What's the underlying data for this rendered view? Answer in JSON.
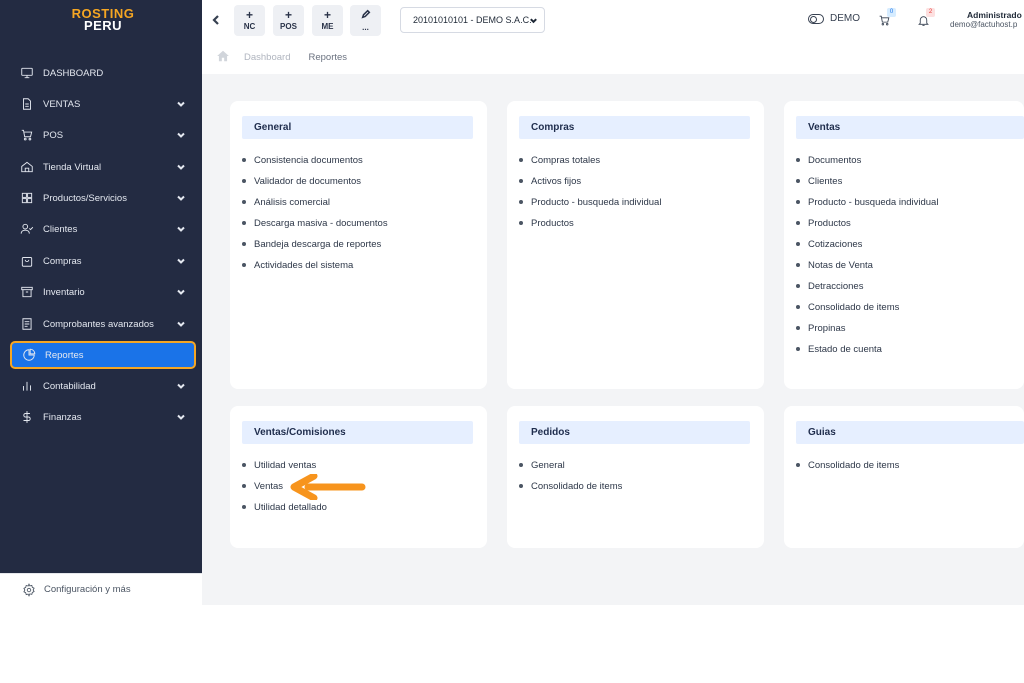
{
  "logo": {
    "line1": "ROSTING",
    "line2": "PERU"
  },
  "sidebar": {
    "items": [
      {
        "label": "DASHBOARD",
        "icon": "monitor-icon",
        "has_chevron": false
      },
      {
        "label": "VENTAS",
        "icon": "document-icon",
        "has_chevron": true
      },
      {
        "label": "POS",
        "icon": "cart-icon",
        "has_chevron": true
      },
      {
        "label": "Tienda Virtual",
        "icon": "home-icon",
        "has_chevron": true
      },
      {
        "label": "Productos/Servicios",
        "icon": "grid-icon",
        "has_chevron": true
      },
      {
        "label": "Clientes",
        "icon": "user-check-icon",
        "has_chevron": true
      },
      {
        "label": "Compras",
        "icon": "bag-icon",
        "has_chevron": true
      },
      {
        "label": "Inventario",
        "icon": "archive-icon",
        "has_chevron": true
      },
      {
        "label": "Comprobantes avanzados",
        "icon": "file-text-icon",
        "has_chevron": true
      },
      {
        "label": "Reportes",
        "icon": "pie-chart-icon",
        "has_chevron": false,
        "active": true
      },
      {
        "label": "Contabilidad",
        "icon": "bar-chart-icon",
        "has_chevron": true
      },
      {
        "label": "Finanzas",
        "icon": "dollar-icon",
        "has_chevron": true
      }
    ],
    "footer_label": "Configuración y más"
  },
  "header": {
    "quick_buttons": [
      {
        "label": "NC",
        "icon": "plus-icon"
      },
      {
        "label": "POS",
        "icon": "plus-icon"
      },
      {
        "label": "ME",
        "icon": "plus-icon"
      },
      {
        "label": "...",
        "icon": "edit-icon"
      }
    ],
    "company_select": "20101010101 - DEMO S.A.C.",
    "demo_label": "DEMO",
    "cart_count": "0",
    "notification_count": "2",
    "user_name": "Administrado",
    "user_email": "demo@factuhost.p"
  },
  "breadcrumb": {
    "items": [
      "Dashboard",
      "Reportes"
    ]
  },
  "cards": [
    {
      "title": "General",
      "items": [
        "Consistencia documentos",
        "Validador de documentos",
        "Análisis comercial",
        "Descarga masiva - documentos",
        "Bandeja descarga de reportes",
        "Actividades del sistema"
      ]
    },
    {
      "title": "Compras",
      "items": [
        "Compras totales",
        "Activos fijos",
        "Producto - busqueda individual",
        "Productos"
      ]
    },
    {
      "title": "Ventas",
      "items": [
        "Documentos",
        "Clientes",
        "Producto - busqueda individual",
        "Productos",
        "Cotizaciones",
        "Notas de Venta",
        "Detracciones",
        "Consolidado de items",
        "Propinas",
        "Estado de cuenta"
      ]
    },
    {
      "title": "Ventas/Comisiones",
      "items": [
        "Utilidad ventas",
        "Ventas",
        "Utilidad detallado"
      ]
    },
    {
      "title": "Pedidos",
      "items": [
        "General",
        "Consolidado de items"
      ]
    },
    {
      "title": "Guias",
      "items": [
        "Consolidado de items"
      ]
    }
  ],
  "colors": {
    "sidebar_bg": "#232b42",
    "active_bg": "#1a73e8",
    "active_border": "#f5a623",
    "arrow": "#f7941d",
    "card_header_bg": "#e6efff"
  }
}
